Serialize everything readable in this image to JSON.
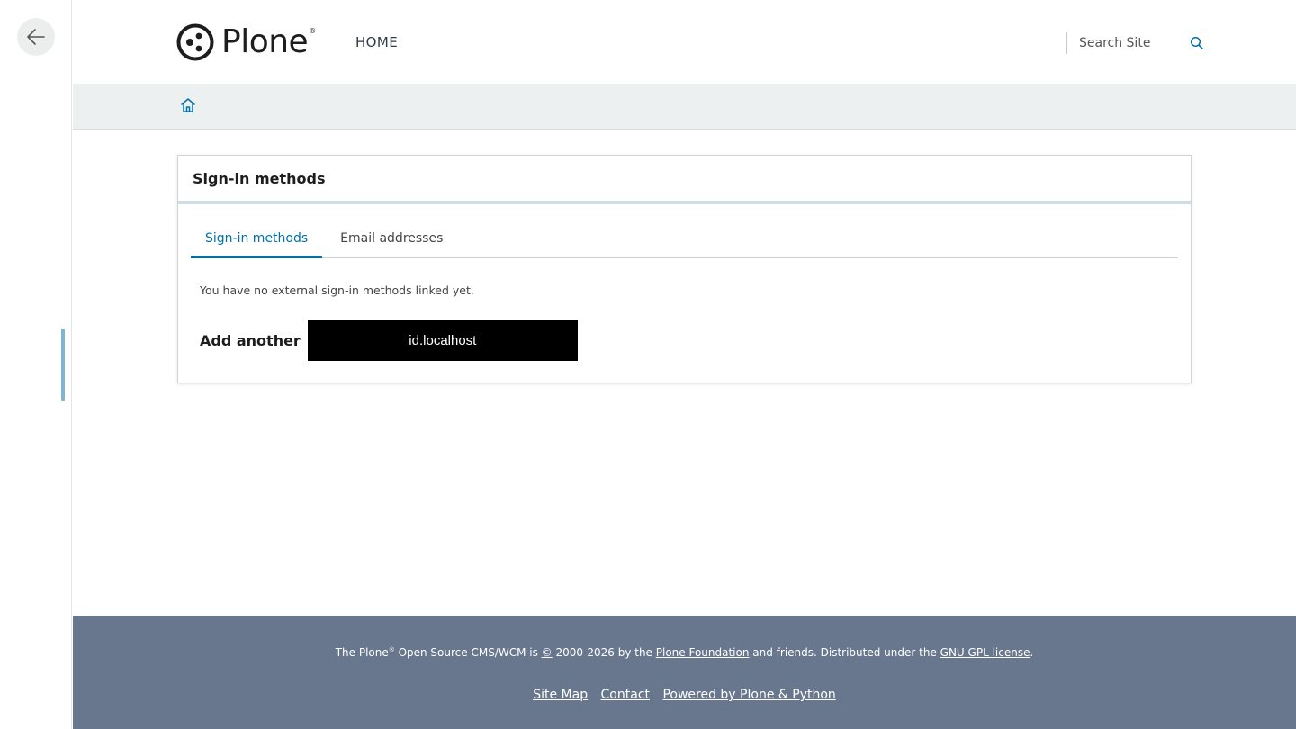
{
  "header": {
    "logo_text": "Plone",
    "logo_reg": "®",
    "nav_home": "HOME",
    "search_placeholder": "Search Site"
  },
  "card": {
    "title": "Sign-in methods",
    "tabs": [
      {
        "label": "Sign-in methods",
        "active": true
      },
      {
        "label": "Email addresses",
        "active": false
      }
    ],
    "no_methods_text": "You have no external sign-in methods linked yet.",
    "add_label": "Add another",
    "provider_label": "id.localhost"
  },
  "footer": {
    "line_prefix": "The Plone",
    "line_reg": "®",
    "line_mid": " Open Source CMS/WCM is ",
    "copyright_symbol": "©",
    "line_years": " 2000-2026 by the ",
    "foundation_link": "Plone Foundation",
    "line_friends": " and friends. Distributed under the ",
    "license_link": "GNU GPL license",
    "line_end": ".",
    "links": [
      "Site Map",
      "Contact",
      "Powered by Plone & Python"
    ]
  },
  "colors": {
    "accent": "#0070a8",
    "footer_bg": "#68778d",
    "breadcrumb_bg": "#ecf0f1"
  },
  "icons": [
    "back-arrow-icon",
    "plone-logo-icon",
    "search-icon",
    "home-icon"
  ]
}
